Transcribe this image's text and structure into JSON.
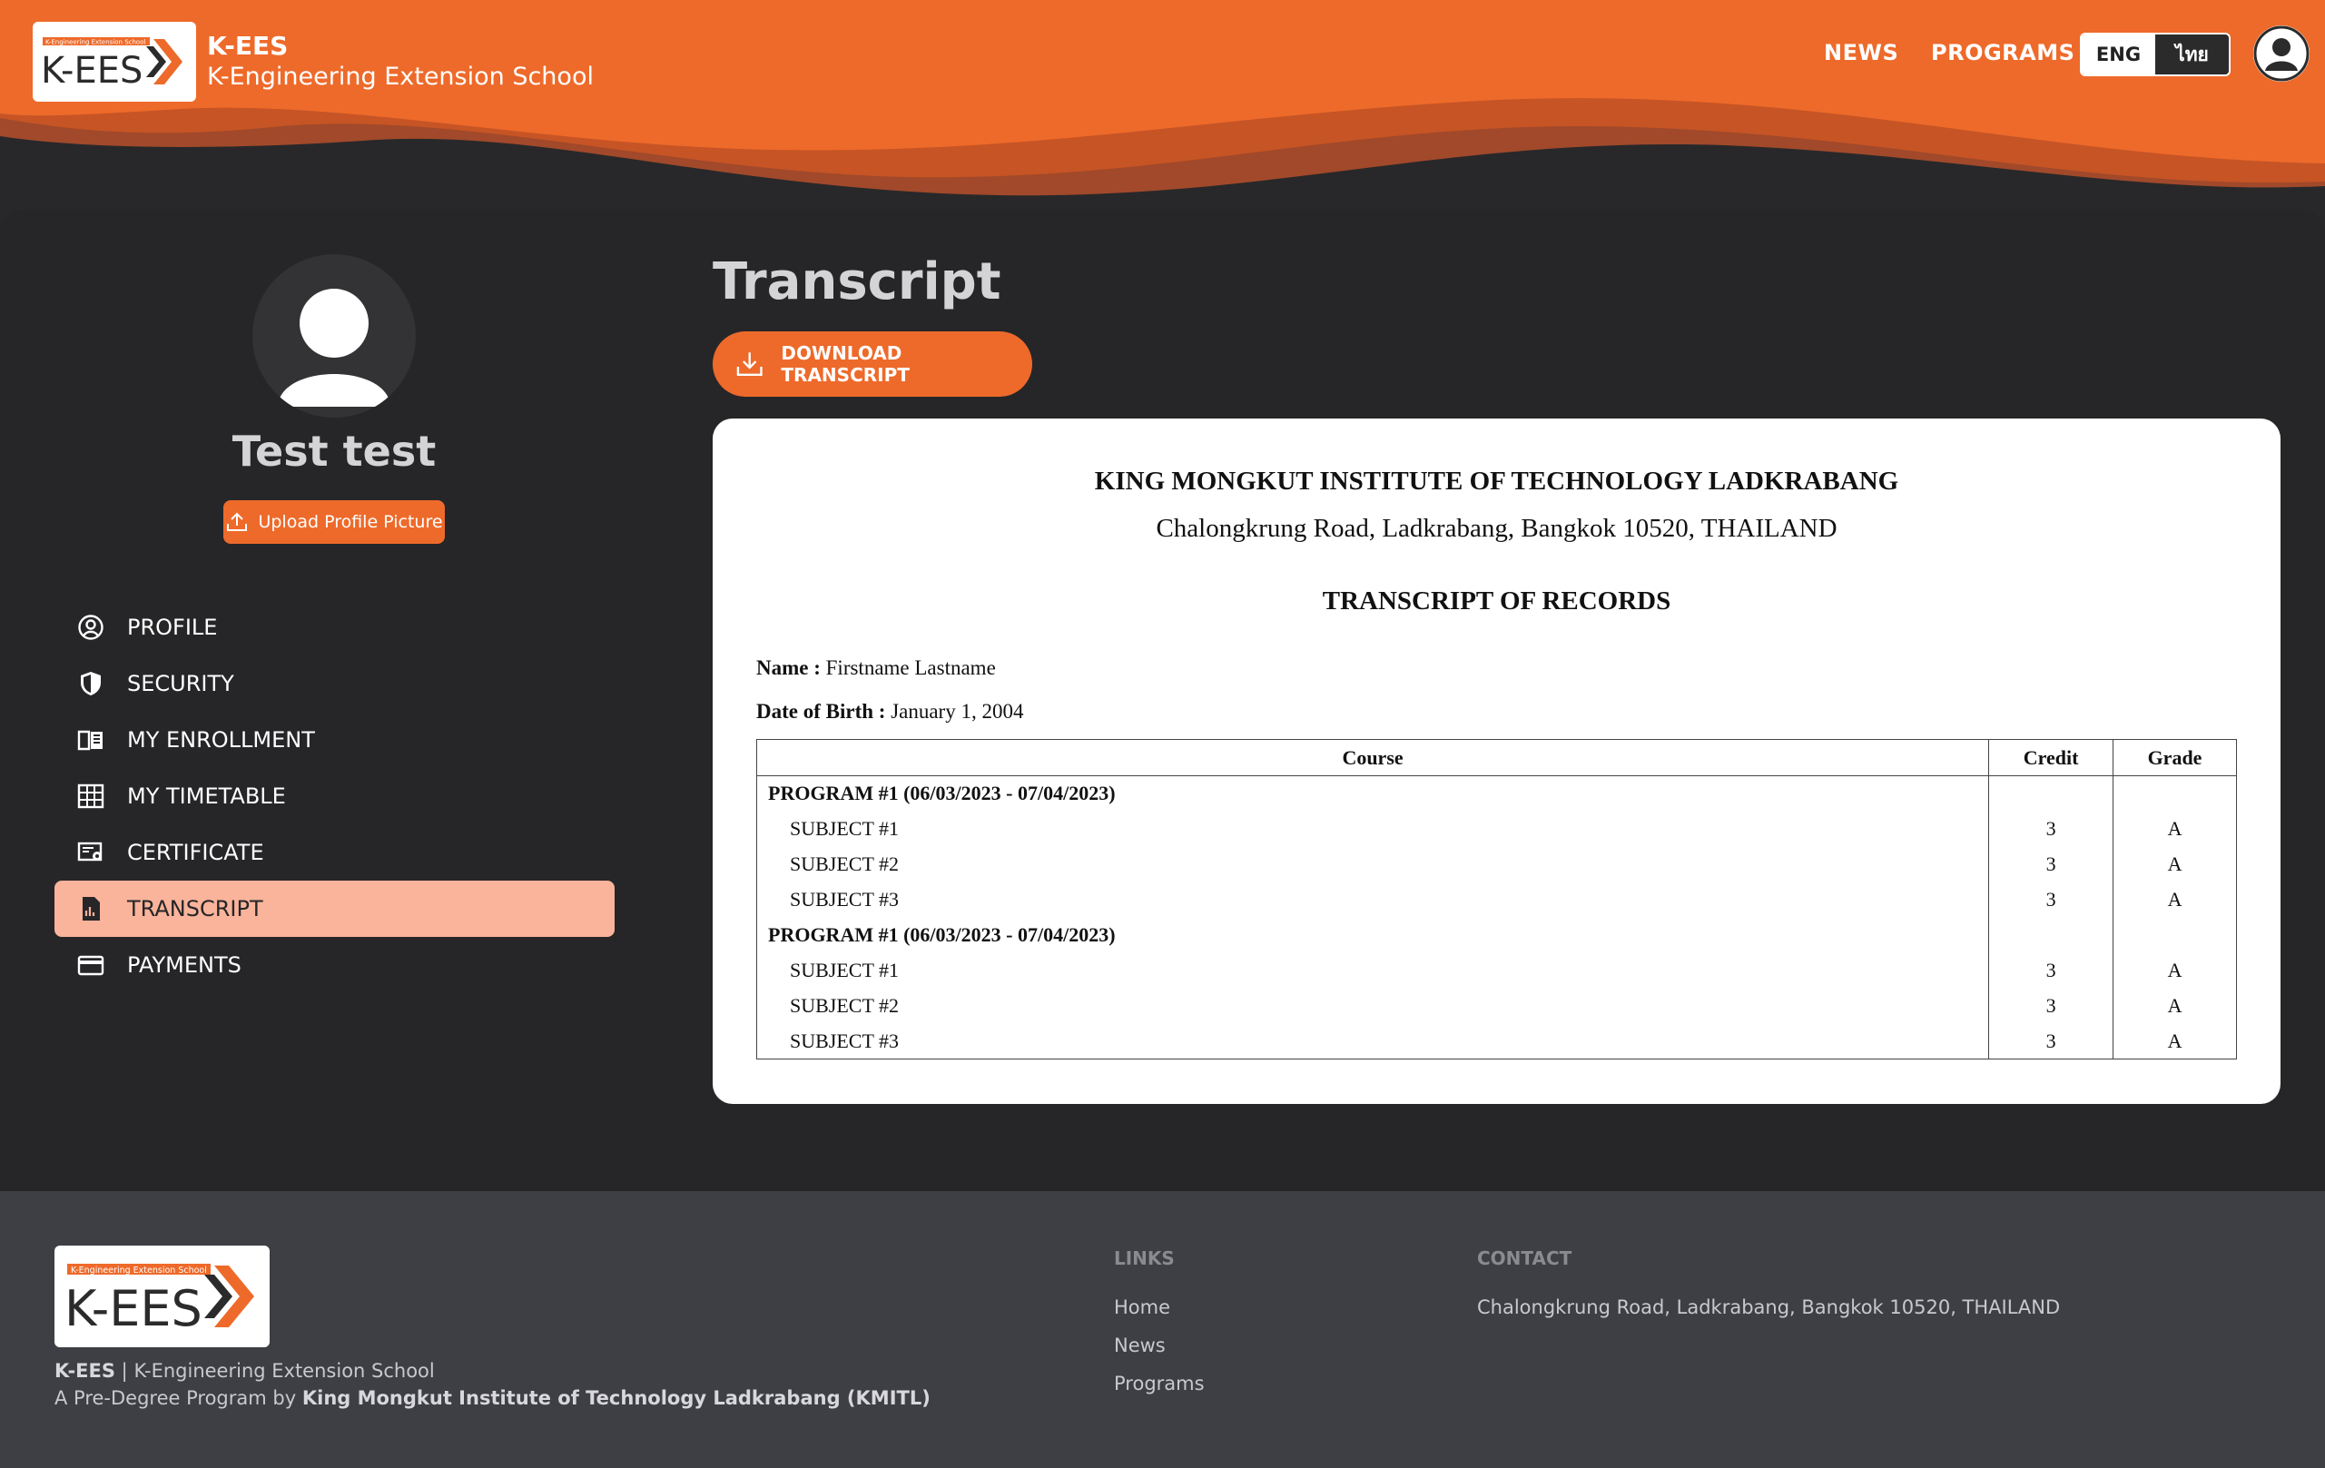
{
  "brand": {
    "logo_text": "K-EES",
    "logo_tagline": "K-Engineering Extension School",
    "title": "K-EES",
    "subtitle": "K-Engineering Extension School"
  },
  "nav": {
    "news": "NEWS",
    "programs": "PROGRAMS",
    "lang_eng": "ENG",
    "lang_thai": "ไทย"
  },
  "colors": {
    "accent": "#ee6a2a",
    "active_menu": "#f9b49b",
    "background": "#28282a",
    "footer": "#3e3f44"
  },
  "profile": {
    "name": "Test test",
    "upload_label": "Upload Profile Picture"
  },
  "sidebar": {
    "items": [
      {
        "label": "PROFILE",
        "icon": "user-circle-icon"
      },
      {
        "label": "SECURITY",
        "icon": "shield-icon"
      },
      {
        "label": "MY ENROLLMENT",
        "icon": "book-icon"
      },
      {
        "label": "MY TIMETABLE",
        "icon": "grid-icon"
      },
      {
        "label": "CERTIFICATE",
        "icon": "certificate-icon"
      },
      {
        "label": "TRANSCRIPT",
        "icon": "document-chart-icon",
        "active": true
      },
      {
        "label": "PAYMENTS",
        "icon": "credit-card-icon"
      }
    ]
  },
  "main": {
    "title": "Transcript",
    "download_label": "DOWNLOAD TRANSCRIPT"
  },
  "transcript": {
    "institution": "KING MONGKUT INSTITUTE OF TECHNOLOGY LADKRABANG",
    "address": "Chalongkrung Road, Ladkrabang, Bangkok 10520, THAILAND",
    "heading": "TRANSCRIPT OF RECORDS",
    "name_label": "Name :",
    "name_value": "Firstname Lastname",
    "dob_label": "Date of Birth :",
    "dob_value": "January 1, 2004",
    "columns": [
      "Course",
      "Credit",
      "Grade"
    ],
    "rows": [
      {
        "type": "program",
        "course": "PROGRAM #1 (06/03/2023 - 07/04/2023)",
        "credit": "",
        "grade": ""
      },
      {
        "type": "subject",
        "course": "SUBJECT #1",
        "credit": "3",
        "grade": "A"
      },
      {
        "type": "subject",
        "course": "SUBJECT #2",
        "credit": "3",
        "grade": "A"
      },
      {
        "type": "subject",
        "course": "SUBJECT #3",
        "credit": "3",
        "grade": "A"
      },
      {
        "type": "program",
        "course": "PROGRAM #1 (06/03/2023 - 07/04/2023)",
        "credit": "",
        "grade": ""
      },
      {
        "type": "subject",
        "course": "SUBJECT #1",
        "credit": "3",
        "grade": "A"
      },
      {
        "type": "subject",
        "course": "SUBJECT #2",
        "credit": "3",
        "grade": "A"
      },
      {
        "type": "subject",
        "course": "SUBJECT #3",
        "credit": "3",
        "grade": "A"
      }
    ]
  },
  "footer": {
    "brand_short": "K-EES",
    "separator": "|",
    "brand_long": "K-Engineering Extension School",
    "program_prefix": "A Pre-Degree Program by",
    "program_org": "King Mongkut Institute of Technology Ladkrabang (KMITL)",
    "links_heading": "LINKS",
    "links": [
      "Home",
      "News",
      "Programs"
    ],
    "contact_heading": "CONTACT",
    "contact_address": "Chalongkrung Road, Ladkrabang, Bangkok 10520, THAILAND"
  }
}
